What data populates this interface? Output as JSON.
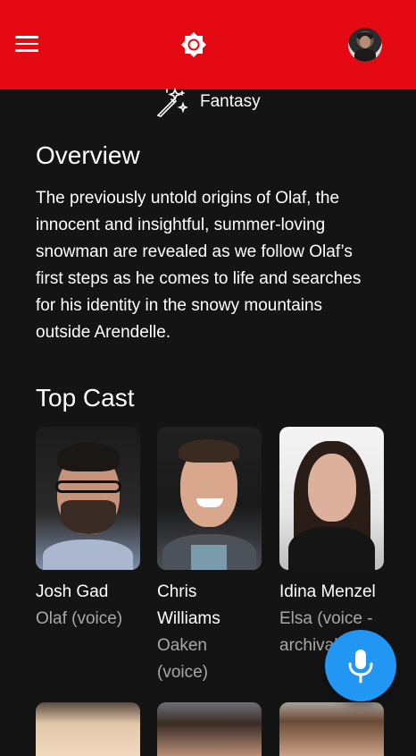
{
  "header": {
    "menu_icon": "hamburger-menu-icon",
    "theme_icon": "brightness-icon",
    "avatar_icon": "profile-avatar",
    "brand_color": "#e50914"
  },
  "genre": {
    "icon": "magic-wand-icon",
    "label": "Fantasy"
  },
  "overview": {
    "title": "Overview",
    "text": "The previously untold origins of Olaf, the innocent and insightful, summer-loving snowman are revealed as we follow Olaf’s first steps as he comes to life and searches for his identity in the snowy mountains outside Arendelle."
  },
  "cast": {
    "title": "Top Cast",
    "members": [
      {
        "name": "Josh Gad",
        "role": "Olaf (voice)"
      },
      {
        "name": "Chris Williams",
        "role": "Oaken (voice)"
      },
      {
        "name": "Idina Menzel",
        "role": "Elsa (voice - archival)"
      }
    ]
  },
  "fab": {
    "icon": "microphone-icon",
    "color": "#2196f3"
  }
}
